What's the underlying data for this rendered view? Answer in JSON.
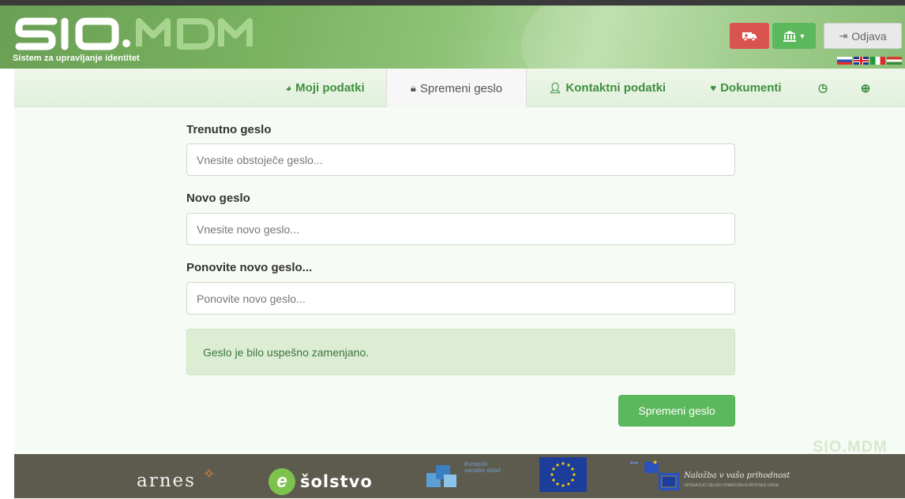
{
  "header": {
    "logo_text": "SIO.MDM",
    "tagline": "Sistem za upravljanje identitet",
    "logout_label": "Odjava",
    "icons": [
      "ambulance-icon",
      "institution-icon",
      "logout-icon"
    ],
    "languages": [
      "sl",
      "en",
      "it",
      "hu"
    ]
  },
  "nav": {
    "tabs": [
      {
        "label": "Moji podatki",
        "icon": "tachometer-icon"
      },
      {
        "label": "Spremeni geslo",
        "icon": "lock-icon",
        "active": true
      },
      {
        "label": "Kontaktni podatki",
        "icon": "user-icon"
      },
      {
        "label": "Dokumenti",
        "icon": "heart-icon"
      },
      {
        "label": "",
        "icon": "clock-icon"
      },
      {
        "label": "",
        "icon": "help-icon"
      }
    ]
  },
  "form": {
    "current": {
      "label": "Trenutno geslo",
      "placeholder": "Vnesite obstoječe geslo...",
      "value": ""
    },
    "new": {
      "label": "Novo geslo",
      "placeholder": "Vnesite novo geslo...",
      "value": ""
    },
    "repeat": {
      "label": "Ponovite novo geslo...",
      "placeholder": "Ponovite novo geslo...",
      "value": ""
    },
    "success_message": "Geslo je bilo uspešno zamenjano.",
    "submit_label": "Spremeni geslo"
  },
  "watermark": "SIO.MDM",
  "footer": {
    "arnes": "arnes",
    "solstvo": "šolstvo",
    "esf_text": "Evropski socialni sklad",
    "investment": "Naložba v vašo prihodnost",
    "investment_sub": "OPERACIJO DELNO FINANCIRA EVROPSKA UNIJA"
  },
  "colors": {
    "brand_green": "#5cb85c",
    "nav_text": "#3f8f3f",
    "danger": "#d9534f",
    "footer_bg": "#5d5b4e"
  }
}
